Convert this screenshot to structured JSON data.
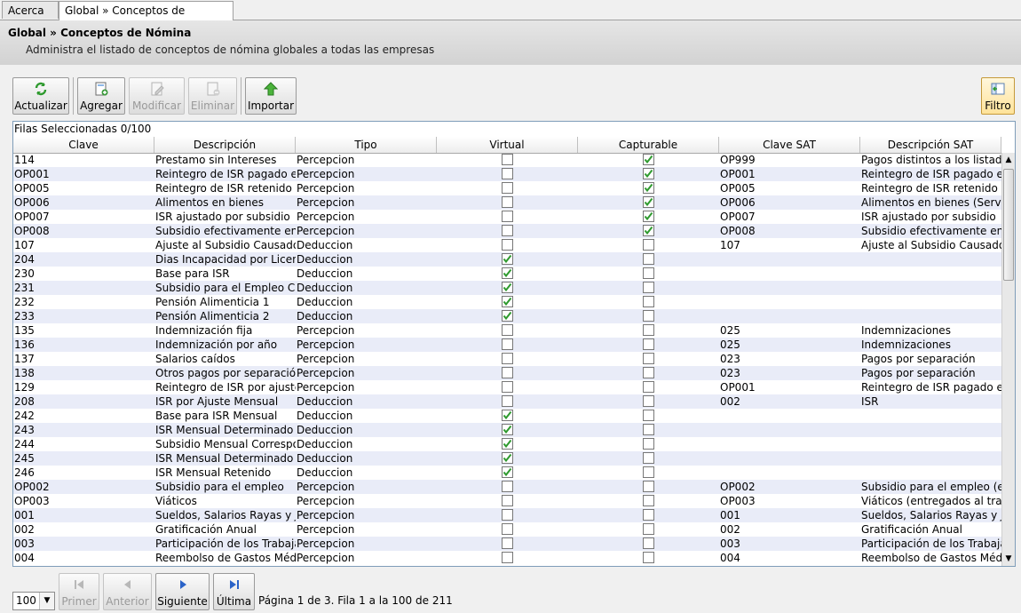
{
  "tabs": [
    {
      "label": "Acerca de"
    },
    {
      "label": "Global » Conceptos de Nómina",
      "close": "✕"
    }
  ],
  "header": {
    "title": "Global » Conceptos de Nómina",
    "subtitle": "Administra el listado de conceptos de nómina globales a todas las empresas"
  },
  "toolbar": {
    "actualizar": "Actualizar",
    "agregar": "Agregar",
    "modificar": "Modificar",
    "eliminar": "Eliminar",
    "importar": "Importar",
    "filtro": "Filtro"
  },
  "grid": {
    "selected_label": "Filas Seleccionadas  0/100",
    "columns": [
      "Clave",
      "Descripción",
      "Tipo",
      "Virtual",
      "Capturable",
      "Clave SAT",
      "Descripción SAT"
    ],
    "rows": [
      {
        "clave": "114",
        "desc": "Prestamo sin Intereses",
        "tipo": "Percepcion",
        "virtual": false,
        "capturable": true,
        "clave_sat": "OP999",
        "desc_sat": "Pagos distintos a los listado..."
      },
      {
        "clave": "OP001",
        "desc": "Reintegro de ISR pagado en...",
        "tipo": "Percepcion",
        "virtual": false,
        "capturable": true,
        "clave_sat": "OP001",
        "desc_sat": "Reintegro de ISR pagado en..."
      },
      {
        "clave": "OP005",
        "desc": "Reintegro de ISR retenido e...",
        "tipo": "Percepcion",
        "virtual": false,
        "capturable": true,
        "clave_sat": "OP005",
        "desc_sat": "Reintegro de ISR retenido e..."
      },
      {
        "clave": "OP006",
        "desc": "Alimentos en bienes",
        "tipo": "Percepcion",
        "virtual": false,
        "capturable": true,
        "clave_sat": "OP006",
        "desc_sat": "Alimentos en bienes (Servic..."
      },
      {
        "clave": "OP007",
        "desc": "ISR ajustado por subsidio",
        "tipo": "Percepcion",
        "virtual": false,
        "capturable": true,
        "clave_sat": "OP007",
        "desc_sat": "ISR ajustado por subsidio"
      },
      {
        "clave": "OP008",
        "desc": "Subsidio efectivamente entr...",
        "tipo": "Percepcion",
        "virtual": false,
        "capturable": true,
        "clave_sat": "OP008",
        "desc_sat": "Subsidio efectivamente entr..."
      },
      {
        "clave": "107",
        "desc": "Ajuste al Subsidio Causado",
        "tipo": "Deduccion",
        "virtual": false,
        "capturable": false,
        "clave_sat": "107",
        "desc_sat": "Ajuste al Subsidio Causado"
      },
      {
        "clave": "204",
        "desc": "Dias Incapacidad por Licenc...",
        "tipo": "Deduccion",
        "virtual": true,
        "capturable": false,
        "clave_sat": "",
        "desc_sat": ""
      },
      {
        "clave": "230",
        "desc": "Base para ISR",
        "tipo": "Deduccion",
        "virtual": true,
        "capturable": false,
        "clave_sat": "",
        "desc_sat": ""
      },
      {
        "clave": "231",
        "desc": "Subsidio para el Empleo Ca...",
        "tipo": "Deduccion",
        "virtual": true,
        "capturable": false,
        "clave_sat": "",
        "desc_sat": ""
      },
      {
        "clave": "232",
        "desc": "Pensión Alimenticia 1",
        "tipo": "Deduccion",
        "virtual": true,
        "capturable": false,
        "clave_sat": "",
        "desc_sat": ""
      },
      {
        "clave": "233",
        "desc": "Pensión Alimenticia 2",
        "tipo": "Deduccion",
        "virtual": true,
        "capturable": false,
        "clave_sat": "",
        "desc_sat": ""
      },
      {
        "clave": "135",
        "desc": "Indemnización fija",
        "tipo": "Percepcion",
        "virtual": false,
        "capturable": false,
        "clave_sat": "025",
        "desc_sat": "Indemnizaciones"
      },
      {
        "clave": "136",
        "desc": "Indemnización por año",
        "tipo": "Percepcion",
        "virtual": false,
        "capturable": false,
        "clave_sat": "025",
        "desc_sat": "Indemnizaciones"
      },
      {
        "clave": "137",
        "desc": "Salarios caídos",
        "tipo": "Percepcion",
        "virtual": false,
        "capturable": false,
        "clave_sat": "023",
        "desc_sat": "Pagos por separación"
      },
      {
        "clave": "138",
        "desc": "Otros pagos por separación",
        "tipo": "Percepcion",
        "virtual": false,
        "capturable": false,
        "clave_sat": "023",
        "desc_sat": "Pagos por separación"
      },
      {
        "clave": "129",
        "desc": "Reintegro de ISR por ajuste ...",
        "tipo": "Percepcion",
        "virtual": false,
        "capturable": false,
        "clave_sat": "OP001",
        "desc_sat": "Reintegro de ISR pagado en..."
      },
      {
        "clave": "208",
        "desc": "ISR por Ajuste Mensual",
        "tipo": "Deduccion",
        "virtual": false,
        "capturable": false,
        "clave_sat": "002",
        "desc_sat": "ISR"
      },
      {
        "clave": "242",
        "desc": "Base para ISR Mensual",
        "tipo": "Deduccion",
        "virtual": true,
        "capturable": false,
        "clave_sat": "",
        "desc_sat": ""
      },
      {
        "clave": "243",
        "desc": "ISR Mensual Determinado A...",
        "tipo": "Deduccion",
        "virtual": true,
        "capturable": false,
        "clave_sat": "",
        "desc_sat": ""
      },
      {
        "clave": "244",
        "desc": "Subsidio Mensual Correspo...",
        "tipo": "Deduccion",
        "virtual": true,
        "capturable": false,
        "clave_sat": "",
        "desc_sat": ""
      },
      {
        "clave": "245",
        "desc": "ISR Mensual Determinado",
        "tipo": "Deduccion",
        "virtual": true,
        "capturable": false,
        "clave_sat": "",
        "desc_sat": ""
      },
      {
        "clave": "246",
        "desc": "ISR Mensual Retenido",
        "tipo": "Deduccion",
        "virtual": true,
        "capturable": false,
        "clave_sat": "",
        "desc_sat": ""
      },
      {
        "clave": "OP002",
        "desc": "Subsidio para el empleo",
        "tipo": "Percepcion",
        "virtual": false,
        "capturable": false,
        "clave_sat": "OP002",
        "desc_sat": "Subsidio para el empleo (ef..."
      },
      {
        "clave": "OP003",
        "desc": "Viáticos",
        "tipo": "Percepcion",
        "virtual": false,
        "capturable": false,
        "clave_sat": "OP003",
        "desc_sat": "Viáticos (entregados al trab..."
      },
      {
        "clave": "001",
        "desc": "Sueldos, Salarios  Rayas y Jo...",
        "tipo": "Percepcion",
        "virtual": false,
        "capturable": false,
        "clave_sat": "001",
        "desc_sat": "Sueldos, Salarios  Rayas y Jo..."
      },
      {
        "clave": "002",
        "desc": "Gratificación Anual",
        "tipo": "Percepcion",
        "virtual": false,
        "capturable": false,
        "clave_sat": "002",
        "desc_sat": "Gratificación Anual"
      },
      {
        "clave": "003",
        "desc": "Participación de los Trabaja...",
        "tipo": "Percepcion",
        "virtual": false,
        "capturable": false,
        "clave_sat": "003",
        "desc_sat": "Participación de los Trabaja..."
      },
      {
        "clave": "004",
        "desc": "Reembolso de Gastos Médi...",
        "tipo": "Percepcion",
        "virtual": false,
        "capturable": false,
        "clave_sat": "004",
        "desc_sat": "Reembolso de Gastos Médi..."
      }
    ]
  },
  "pager": {
    "page_size": "100",
    "primer": "Primer",
    "anterior": "Anterior",
    "siguiente": "Siguiente",
    "ultima": "Última",
    "info": "Página 1 de 3. Fila 1 a la 100 de 211"
  },
  "colors": {
    "alt_row": "#e9ecf8",
    "check": "#2f9a2f",
    "grid_border": "#7f9db9"
  }
}
